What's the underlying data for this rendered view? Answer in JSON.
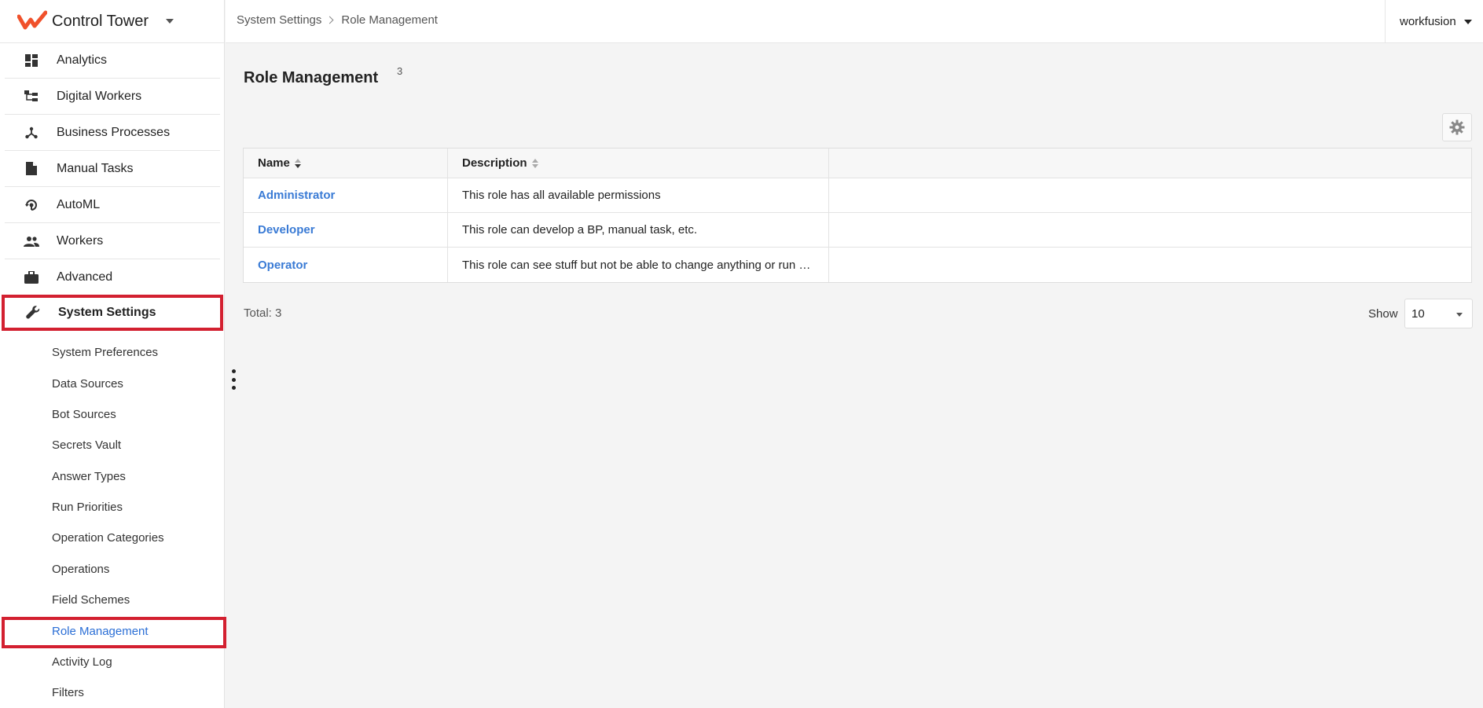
{
  "app": {
    "title": "Control Tower",
    "brand_color": "#f0512b",
    "accent_color": "#d32030",
    "link_color": "#3a7bd5"
  },
  "sidebar": {
    "items": [
      {
        "label": "Analytics",
        "icon": "dashboard-icon"
      },
      {
        "label": "Digital Workers",
        "icon": "hierarchy-icon"
      },
      {
        "label": "Business Processes",
        "icon": "process-icon"
      },
      {
        "label": "Manual Tasks",
        "icon": "document-icon"
      },
      {
        "label": "AutoML",
        "icon": "automl-icon"
      },
      {
        "label": "Workers",
        "icon": "people-icon"
      },
      {
        "label": "Advanced",
        "icon": "briefcase-icon"
      },
      {
        "label": "System Settings",
        "icon": "wrench-icon"
      }
    ],
    "subitems": [
      "System Preferences",
      "Data Sources",
      "Bot Sources",
      "Secrets Vault",
      "Answer Types",
      "Run Priorities",
      "Operation Categories",
      "Operations",
      "Field Schemes",
      "Role Management",
      "Activity Log",
      "Filters"
    ]
  },
  "header": {
    "breadcrumb": [
      "System Settings",
      "Role Management"
    ],
    "user": "workfusion"
  },
  "main": {
    "title": "Role Management",
    "count": "3",
    "table": {
      "columns": [
        "Name",
        "Description"
      ],
      "rows": [
        {
          "name": "Administrator",
          "description": "This role has all available permissions"
        },
        {
          "name": "Developer",
          "description": "This role can develop a BP, manual task, etc."
        },
        {
          "name": "Operator",
          "description": "This role can see stuff but not be able to change anything or run anything"
        }
      ]
    },
    "total": "Total: 3",
    "show_label": "Show",
    "page_size": "10"
  }
}
